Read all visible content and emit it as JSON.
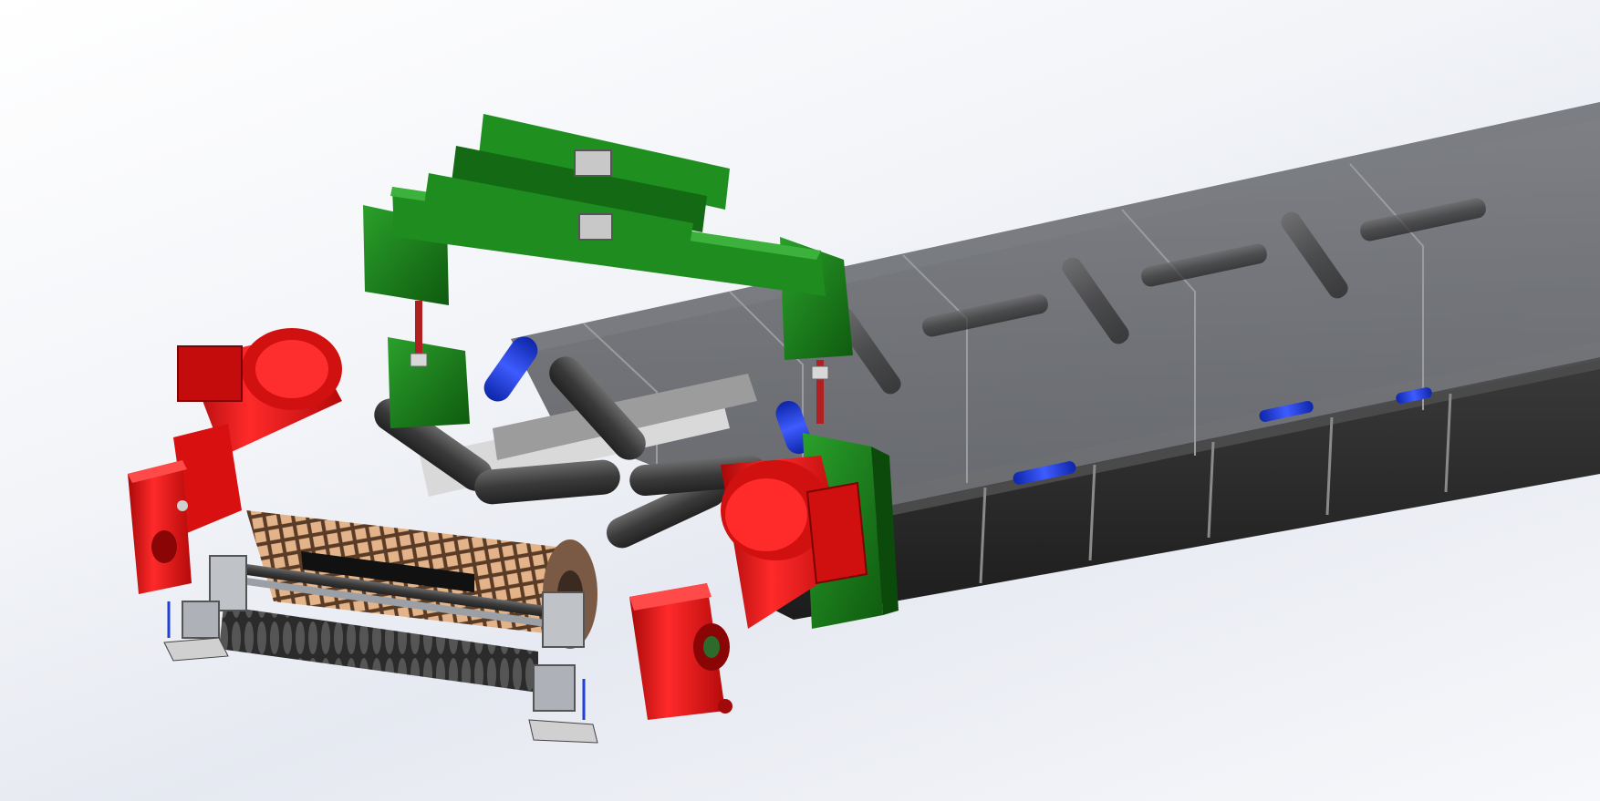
{
  "scene": {
    "background": {
      "top": "#ffffff",
      "mid": "#e6e9f1",
      "bottom": "#f7f8fb"
    },
    "colors": {
      "frame_green": "#1f8a1f",
      "frame_green_dark": "#126312",
      "motor_red": "#e01010",
      "motor_red_dark": "#9e0505",
      "idler_blue": "#1f3fd6",
      "idler_grey": "#4a4a4a",
      "chassis_dark": "#2a2a2a",
      "cover_glass": "#5d5f63",
      "drum_tan": "#d9a57a",
      "drum_lattice": "#6b4a34",
      "steel": "#b8bcc2"
    }
  }
}
